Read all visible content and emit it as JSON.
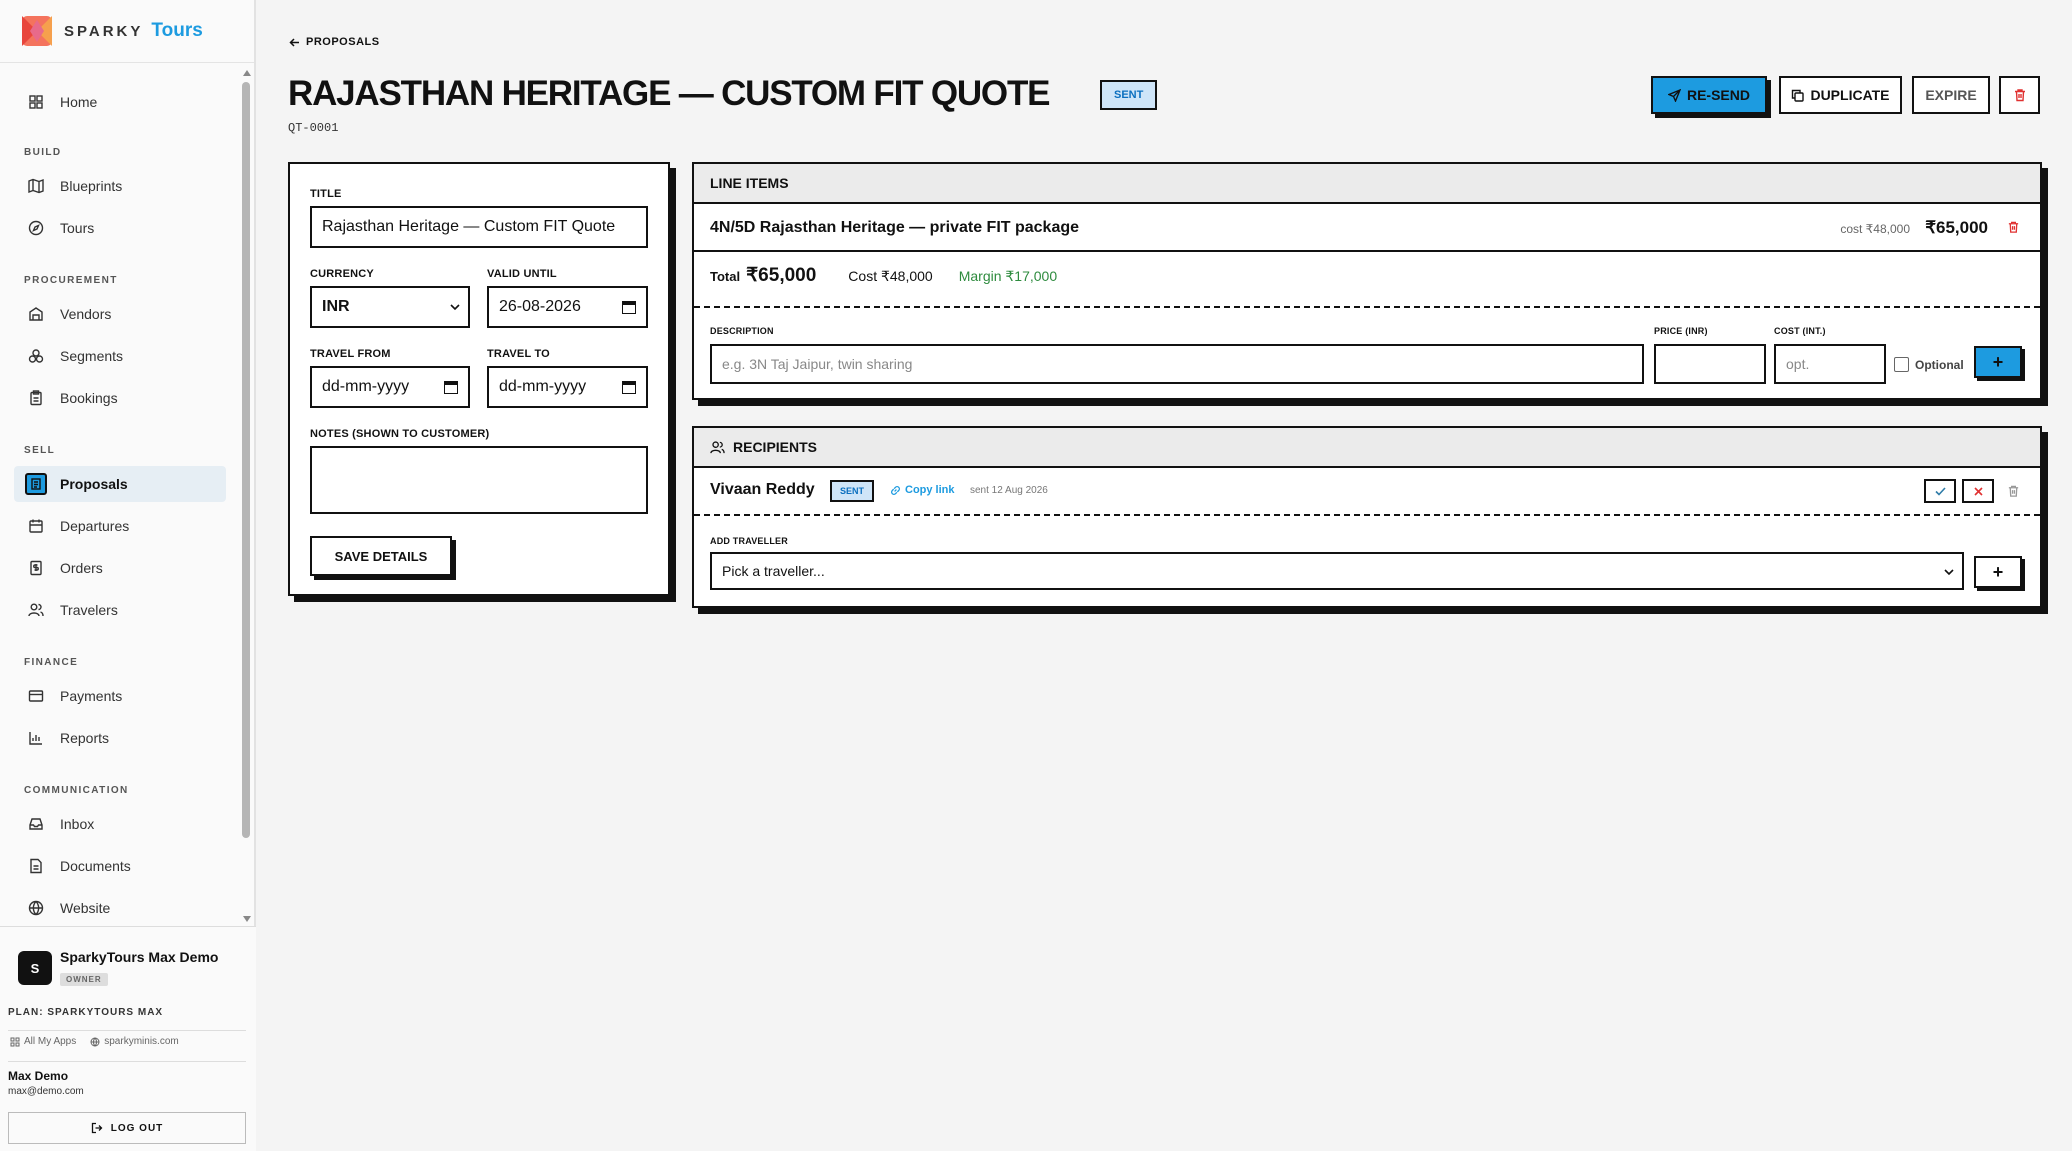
{
  "brand": {
    "name": "SPARKY",
    "accent": "Tours"
  },
  "sidebar": {
    "home": "Home",
    "sections": {
      "build": "BUILD",
      "procurement": "PROCUREMENT",
      "sell": "SELL",
      "finance": "FINANCE",
      "communication": "COMMUNICATION"
    },
    "items": {
      "blueprints": "Blueprints",
      "tours": "Tours",
      "vendors": "Vendors",
      "segments": "Segments",
      "bookings": "Bookings",
      "proposals": "Proposals",
      "departures": "Departures",
      "orders": "Orders",
      "travelers": "Travelers",
      "payments": "Payments",
      "reports": "Reports",
      "inbox": "Inbox",
      "documents": "Documents",
      "website": "Website"
    },
    "active": "proposals",
    "org": {
      "avatar": "S",
      "name": "SparkyTours Max Demo",
      "role": "OWNER"
    },
    "plan": "PLAN: SPARKYTOURS MAX",
    "apps": "All My Apps",
    "site": "sparkyminis.com",
    "user": {
      "name": "Max Demo",
      "email": "max@demo.com"
    },
    "logout": "LOG OUT"
  },
  "header": {
    "back": "PROPOSALS",
    "title": "RAJASTHAN HERITAGE — CUSTOM FIT QUOTE",
    "status": "SENT",
    "quote_id": "QT-0001",
    "actions": {
      "resend": "RE-SEND",
      "duplicate": "DUPLICATE",
      "expire": "EXPIRE"
    }
  },
  "details": {
    "title_label": "TITLE",
    "title_value": "Rajasthan Heritage — Custom FIT Quote",
    "currency_label": "CURRENCY",
    "currency_value": "INR",
    "valid_label": "VALID UNTIL",
    "valid_value": "26-08-2026",
    "from_label": "TRAVEL FROM",
    "from_value": "dd-mm-yyyy",
    "to_label": "TRAVEL TO",
    "to_value": "dd-mm-yyyy",
    "notes_label": "NOTES (SHOWN TO CUSTOMER)",
    "notes_value": "",
    "save": "SAVE DETAILS"
  },
  "line_items": {
    "heading": "LINE ITEMS",
    "items": [
      {
        "description": "4N/5D Rajasthan Heritage — private FIT package",
        "cost": "cost ₹48,000",
        "price": "₹65,000"
      }
    ],
    "total_label": "Total",
    "total_value": "₹65,000",
    "cost_summary": "Cost ₹48,000",
    "margin_summary": "Margin ₹17,000",
    "form": {
      "description_label": "DESCRIPTION",
      "description_placeholder": "e.g. 3N Taj Jaipur, twin sharing",
      "price_label": "PRICE (INR)",
      "cost_label": "COST (INT.)",
      "cost_placeholder": "opt.",
      "optional_label": "Optional",
      "add": "+"
    }
  },
  "recipients": {
    "heading": "RECIPIENTS",
    "list": [
      {
        "name": "Vivaan Reddy",
        "status": "SENT",
        "copy_link": "Copy link",
        "sent": "sent 12 Aug 2026"
      }
    ],
    "add_label": "ADD TRAVELLER",
    "select_placeholder": "Pick a traveller...",
    "add": "+"
  },
  "colors": {
    "accent": "#1d9be0",
    "danger": "#e03131",
    "success": "#2e8b3e",
    "badge_bg": "#cfe5f8"
  }
}
